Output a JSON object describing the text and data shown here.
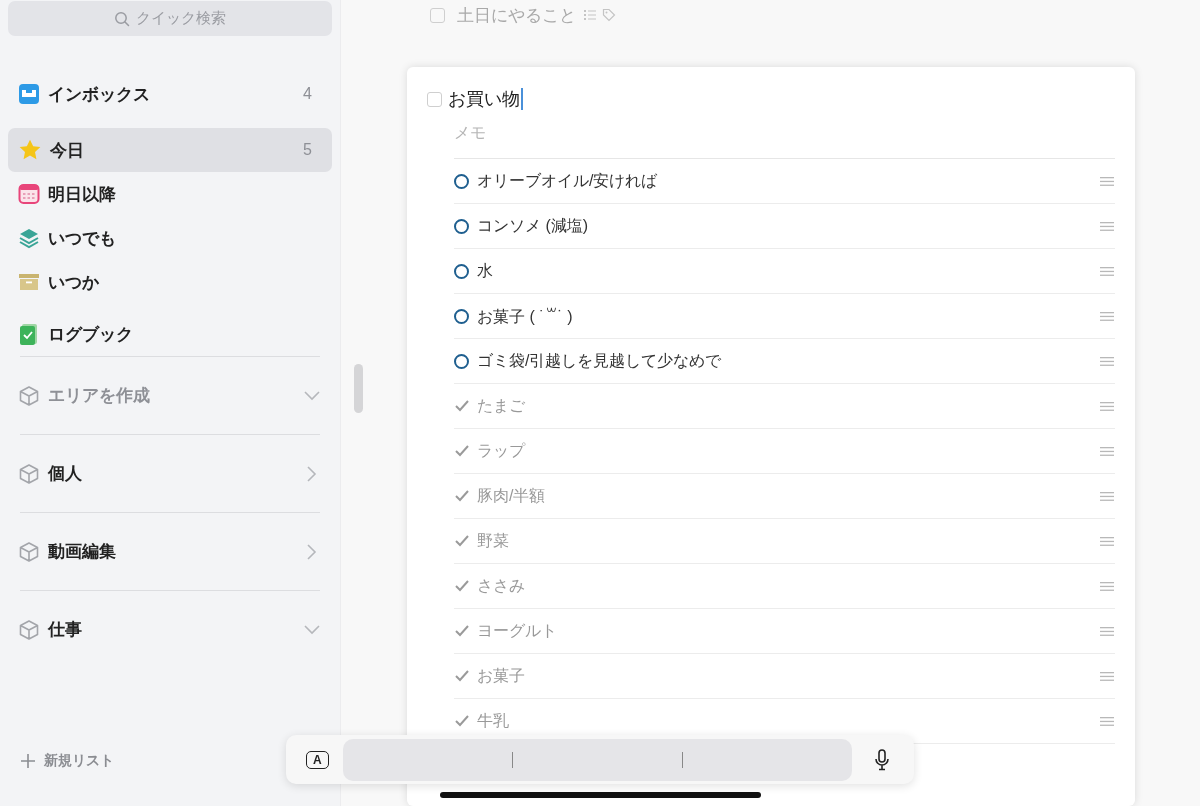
{
  "sidebar": {
    "search": {
      "placeholder": "クイック検索"
    },
    "lists": [
      {
        "kind": "inbox",
        "label": "インボックス",
        "count": "4",
        "selected": false
      },
      {
        "kind": "today",
        "label": "今日",
        "count": "5",
        "selected": true
      },
      {
        "kind": "upcoming",
        "label": "明日以降",
        "selected": false
      },
      {
        "kind": "anytime",
        "label": "いつでも",
        "selected": false
      },
      {
        "kind": "someday",
        "label": "いつか",
        "selected": false
      },
      {
        "kind": "logbook",
        "label": "ログブック",
        "selected": false
      }
    ],
    "areas": [
      {
        "label": "エリアを作成",
        "muted": true,
        "expanded": true
      },
      {
        "label": "個人",
        "muted": false,
        "expanded": false
      },
      {
        "label": "動画編集",
        "muted": false,
        "expanded": false
      },
      {
        "label": "仕事",
        "muted": false,
        "expanded": true
      }
    ],
    "new_list": "新規リスト"
  },
  "main": {
    "previous_task": {
      "title": "土日にやること",
      "checked": false
    },
    "open_task": {
      "title": "お買い物",
      "checked": false,
      "notes": {
        "placeholder": "メモ"
      },
      "checklist": [
        {
          "text": "オリーブオイル/安ければ",
          "done": false
        },
        {
          "text": "コンソメ (減塩)",
          "done": false
        },
        {
          "text": "水",
          "done": false
        },
        {
          "text": "お菓子 ( ˙꒳˙ )",
          "done": false
        },
        {
          "text": "ゴミ袋/引越しを見越して少なめで",
          "done": false
        },
        {
          "text": "たまご",
          "done": true
        },
        {
          "text": "ラップ",
          "done": true
        },
        {
          "text": "豚肉/半額",
          "done": true
        },
        {
          "text": "野菜",
          "done": true
        },
        {
          "text": "ささみ",
          "done": true
        },
        {
          "text": "ヨーグルト",
          "done": true
        },
        {
          "text": "お菓子",
          "done": true
        },
        {
          "text": "牛乳",
          "done": true
        }
      ]
    }
  },
  "keyboard_bar": {
    "key_label": "A"
  }
}
